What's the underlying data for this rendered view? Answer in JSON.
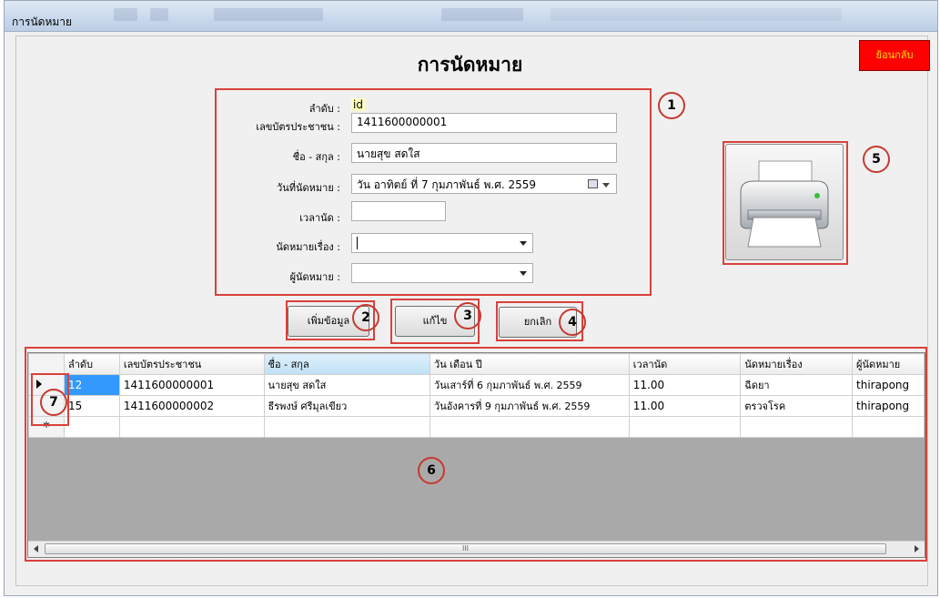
{
  "window": {
    "title": "การนัดหมาย"
  },
  "header": {
    "title": "การนัดหมาย",
    "back_label": "ย้อนกลับ"
  },
  "form": {
    "seq_label": "ลำดับ :",
    "seq_value": "id",
    "id_label": "เลขบัตรประชาชน :",
    "id_value": "1411600000001",
    "name_label": "ชื่อ - สกุล :",
    "name_value": "นายสุข สดใส",
    "date_label": "วันที่นัดหมาย :",
    "date_value": "วัน อาทิตย์ ที่ 7 กุมภาพันธ์ พ.ศ. 2559",
    "time_label": "เวลานัด :",
    "time_value": "",
    "subject_label": "นัดหมายเรื่อง :",
    "subject_value": "",
    "by_label": "ผู้นัดหมาย :",
    "by_value": ""
  },
  "buttons": {
    "add": "เพิ่มข้อมูล",
    "edit": "แก้ไข",
    "cancel": "ยกเลิก"
  },
  "grid": {
    "columns": [
      "ลำดับ",
      "เลขบัตรประชาชน",
      "ชื่อ - สกุล",
      "วัน เดือน ปี",
      "เวลานัด",
      "นัดหมายเรื่อง",
      "ผู้นัดหมาย"
    ],
    "rows": [
      [
        "12",
        "1411600000001",
        "นายสุข สดใส",
        "วันเสาร์ที่ 6 กุมภาพันธ์ พ.ศ. 2559",
        "11.00",
        "ฉีดยา",
        "thirapong"
      ],
      [
        "15",
        "1411600000002",
        "ธีรพงษ์ ศรีมุลเขียว",
        "วันอังคารที่ 9 กุมภาพันธ์ พ.ศ. 2559",
        "11.00",
        "ตรวจโรค",
        "thirapong"
      ]
    ],
    "new_row_marker": "*",
    "scroll_grip": "III"
  },
  "annotations": {
    "n1": "1",
    "n2": "2",
    "n3": "3",
    "n4": "4",
    "n5": "5",
    "n6": "6",
    "n7": "7"
  },
  "colors": {
    "back_button_bg": "#ff0000",
    "back_button_text": "#ffe000",
    "annotation_red": "#d9413c",
    "selected_cell": "#3399ff",
    "grid_bg": "#a9a9a9"
  }
}
